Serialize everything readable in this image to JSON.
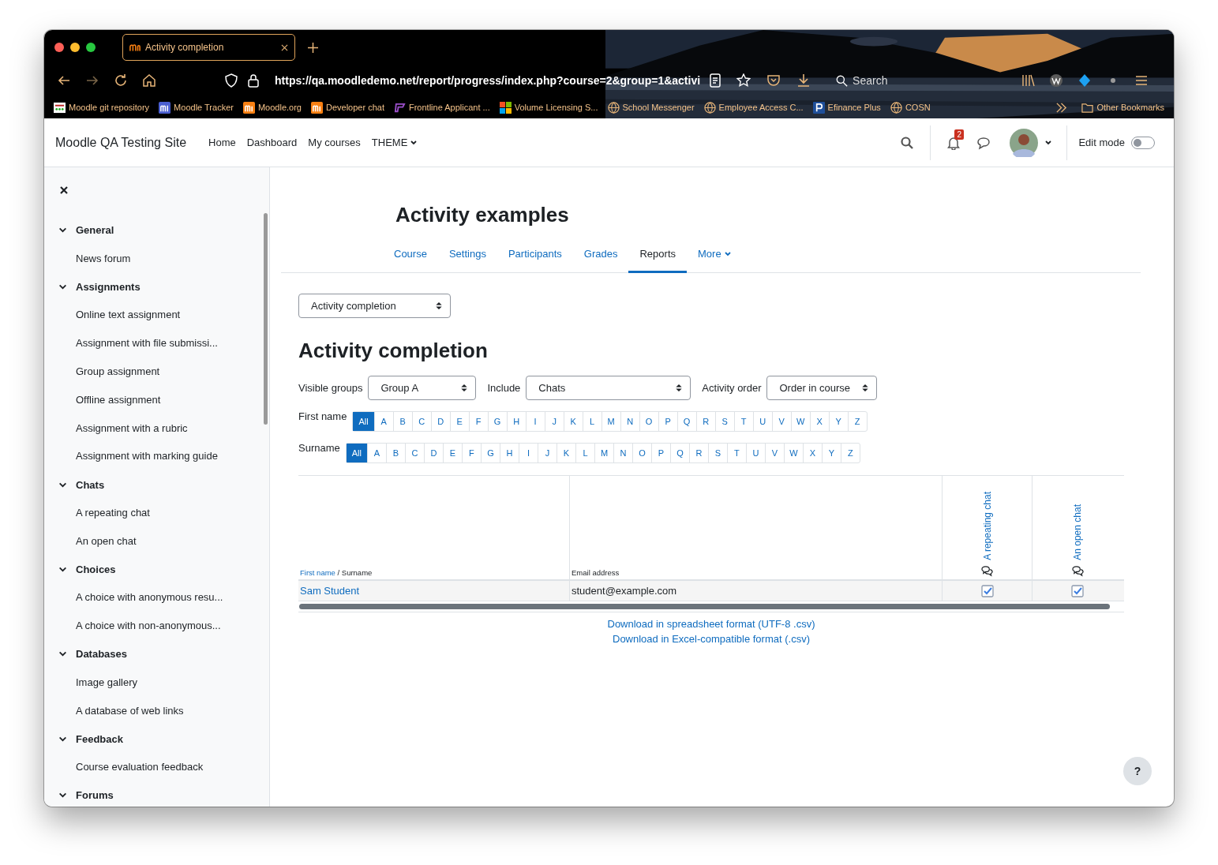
{
  "browser": {
    "tab_title": "Activity completion",
    "url": "https://qa.moodledemo.net/report/progress/index.php?course=2&group=1&activi",
    "search_placeholder": "Search",
    "bookmarks": [
      {
        "label": "Moodle git repository",
        "kind": "grid"
      },
      {
        "label": "Moodle Tracker",
        "kind": "tracker"
      },
      {
        "label": "Moodle.org",
        "kind": "moodle"
      },
      {
        "label": "Developer chat",
        "kind": "moodle"
      },
      {
        "label": "Frontline Applicant ...",
        "kind": "frontline"
      },
      {
        "label": "Volume Licensing S...",
        "kind": "windows"
      },
      {
        "label": "School Messenger",
        "kind": "globe"
      },
      {
        "label": "Employee Access C...",
        "kind": "globe"
      },
      {
        "label": "Efinance Plus",
        "kind": "p"
      },
      {
        "label": "COSN",
        "kind": "globe"
      }
    ],
    "other_bookmarks": "Other Bookmarks"
  },
  "navbar": {
    "site_name": "Moodle QA Testing Site",
    "links": [
      "Home",
      "Dashboard",
      "My courses"
    ],
    "theme_menu": "THEME",
    "notification_count": "2",
    "edit_mode_label": "Edit mode",
    "edit_mode_on": false
  },
  "sidebar": {
    "sections": [
      {
        "title": "General",
        "expanded": true,
        "children": [
          "News forum"
        ]
      },
      {
        "title": "Assignments",
        "expanded": true,
        "children": [
          "Online text assignment",
          "Assignment with file submissi...",
          "Group assignment",
          "Offline assignment",
          "Assignment with a rubric",
          "Assignment with marking guide"
        ]
      },
      {
        "title": "Chats",
        "expanded": true,
        "children": [
          "A repeating chat",
          "An open chat"
        ]
      },
      {
        "title": "Choices",
        "expanded": true,
        "children": [
          "A choice with anonymous resu...",
          "A choice with non-anonymous..."
        ]
      },
      {
        "title": "Databases",
        "expanded": true,
        "children": [
          "Image gallery",
          "A database of web links"
        ]
      },
      {
        "title": "Feedback",
        "expanded": true,
        "children": [
          "Course evaluation feedback"
        ]
      },
      {
        "title": "Forums",
        "expanded": true
      }
    ]
  },
  "course": {
    "title": "Activity examples",
    "tabs": [
      {
        "label": "Course",
        "selected": false
      },
      {
        "label": "Settings",
        "selected": false
      },
      {
        "label": "Participants",
        "selected": false
      },
      {
        "label": "Grades",
        "selected": false
      },
      {
        "label": "Reports",
        "selected": true
      }
    ],
    "more_menu": "More"
  },
  "report": {
    "report_select": "Activity completion",
    "heading": "Activity completion",
    "filters": [
      {
        "label": "Visible groups",
        "value": "Group A"
      },
      {
        "label": "Include",
        "value": "Chats"
      },
      {
        "label": "Activity order",
        "value": "Order in course"
      }
    ],
    "initials_bars": [
      {
        "label": "First name",
        "letters": [
          {
            "text": "All",
            "selected": true
          },
          {
            "text": "A",
            "selected": false
          },
          {
            "text": "B",
            "selected": false
          },
          {
            "text": "C",
            "selected": false
          },
          {
            "text": "D",
            "selected": false
          },
          {
            "text": "E",
            "selected": false
          },
          {
            "text": "F",
            "selected": false
          },
          {
            "text": "G",
            "selected": false
          },
          {
            "text": "H",
            "selected": false
          },
          {
            "text": "I",
            "selected": false
          },
          {
            "text": "J",
            "selected": false
          },
          {
            "text": "K",
            "selected": false
          },
          {
            "text": "L",
            "selected": false
          },
          {
            "text": "M",
            "selected": false
          },
          {
            "text": "N",
            "selected": false
          },
          {
            "text": "O",
            "selected": false
          },
          {
            "text": "P",
            "selected": false
          },
          {
            "text": "Q",
            "selected": false
          },
          {
            "text": "R",
            "selected": false
          },
          {
            "text": "S",
            "selected": false
          },
          {
            "text": "T",
            "selected": false
          },
          {
            "text": "U",
            "selected": false
          },
          {
            "text": "V",
            "selected": false
          },
          {
            "text": "W",
            "selected": false
          },
          {
            "text": "X",
            "selected": false
          },
          {
            "text": "Y",
            "selected": false
          },
          {
            "text": "Z",
            "selected": false
          }
        ]
      },
      {
        "label": "Surname",
        "letters": [
          {
            "text": "All",
            "selected": true
          },
          {
            "text": "A",
            "selected": false
          },
          {
            "text": "B",
            "selected": false
          },
          {
            "text": "C",
            "selected": false
          },
          {
            "text": "D",
            "selected": false
          },
          {
            "text": "E",
            "selected": false
          },
          {
            "text": "F",
            "selected": false
          },
          {
            "text": "G",
            "selected": false
          },
          {
            "text": "H",
            "selected": false
          },
          {
            "text": "I",
            "selected": false
          },
          {
            "text": "J",
            "selected": false
          },
          {
            "text": "K",
            "selected": false
          },
          {
            "text": "L",
            "selected": false
          },
          {
            "text": "M",
            "selected": false
          },
          {
            "text": "N",
            "selected": false
          },
          {
            "text": "O",
            "selected": false
          },
          {
            "text": "P",
            "selected": false
          },
          {
            "text": "Q",
            "selected": false
          },
          {
            "text": "R",
            "selected": false
          },
          {
            "text": "S",
            "selected": false
          },
          {
            "text": "T",
            "selected": false
          },
          {
            "text": "U",
            "selected": false
          },
          {
            "text": "V",
            "selected": false
          },
          {
            "text": "W",
            "selected": false
          },
          {
            "text": "X",
            "selected": false
          },
          {
            "text": "Y",
            "selected": false
          },
          {
            "text": "Z",
            "selected": false
          }
        ]
      }
    ],
    "table": {
      "name_header_link": "First name",
      "name_header_rest": "/ Surname",
      "email_header": "Email address",
      "activities": [
        "A repeating chat",
        "An open chat"
      ],
      "rows": [
        {
          "name": "Sam Student",
          "email": "student@example.com",
          "completions": [
            true,
            true
          ]
        }
      ]
    },
    "downloads": [
      "Download in spreadsheet format (UTF-8 .csv)",
      "Download in Excel-compatible format (.csv)"
    ]
  },
  "help_button": "?"
}
